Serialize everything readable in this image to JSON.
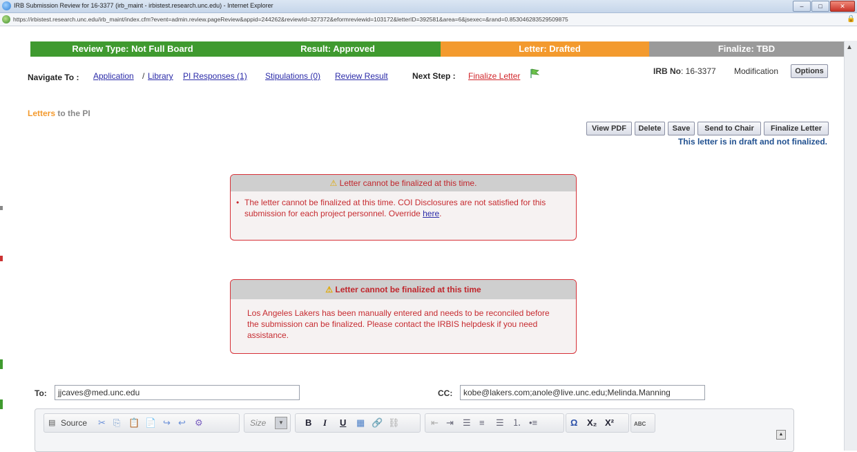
{
  "window": {
    "title": "IRB Submission Review for 16-3377 (irb_maint - irbistest.research.unc.edu) - Internet Explorer",
    "controls": [
      "–",
      "□",
      "✕"
    ]
  },
  "address_bar": {
    "url": "https://irbistest.research.unc.edu/irb_maint/index.cfm?event=admin.review.pageReview&appid=244262&reviewId=327372&eformreviewid=103172&letterID=392581&area=6&jsexec=&rand=0.853046283529509875"
  },
  "steps": [
    {
      "label": "Review Type: Not Full Board",
      "color": "#3f9a2f"
    },
    {
      "label": "Result: Approved",
      "color": "#3f9a2f"
    },
    {
      "label": "Letter: Drafted",
      "color": "#f39a2e"
    },
    {
      "label": "Finalize: TBD",
      "color": "#9a9a9a"
    }
  ],
  "nav": {
    "label": "Navigate To :",
    "links": [
      "Application",
      "Library",
      "PI Responses (1)",
      "Stipulations (0)",
      "Review Result"
    ],
    "separator": "/",
    "next_step_label": "Next Step :",
    "next_step_link": "Finalize Letter"
  },
  "irb": {
    "label": "IRB No",
    "number": ": 16-3377",
    "type": "Modification",
    "options_button": "Options"
  },
  "section": {
    "title_highlight": "Letters",
    "title_rest": " to the PI"
  },
  "actions": {
    "buttons": [
      "View PDF",
      "Delete",
      "Save",
      "Send to Chair",
      "Finalize Letter"
    ],
    "status": "This letter is in draft and not finalized."
  },
  "alerts": [
    {
      "title": "Letter cannot be finalized at this time.",
      "body": "The letter cannot be finalized at this time. COI Disclosures are not satisfied for this submission for each project personnel. Override ",
      "link": "here",
      "suffix": "."
    },
    {
      "title": "Letter cannot be finalized at this time",
      "body": "Los Angeles Lakers has been manually entered and needs to be reconciled before the submission can be finalized. Please contact the IRBIS helpdesk if you need assistance."
    }
  ],
  "form": {
    "to_label": "To:",
    "to_value": "jjcaves@med.unc.edu",
    "cc_label": "CC:",
    "cc_value": "kobe@lakers.com;anole@live.unc.edu;Melinda.Manning"
  },
  "editor": {
    "source_label": "Source",
    "size_label": "Size",
    "bold": "B",
    "italic": "I",
    "underline": "U",
    "omega": "Ω",
    "subscript": "X₂",
    "superscript": "X²",
    "spell": "ABC"
  },
  "colors": {
    "accent_orange": "#f39a2e",
    "link_blue": "#2a2aa8",
    "alert_red": "#c62b30",
    "status_blue": "#1f4f8f"
  }
}
